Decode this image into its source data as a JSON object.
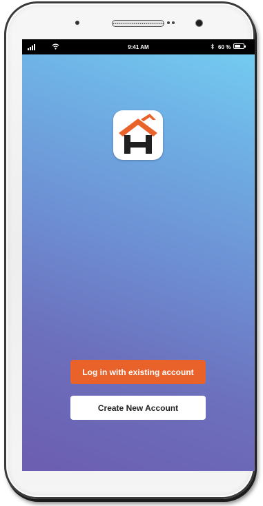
{
  "status_bar": {
    "time": "9:41 AM",
    "battery": "60 %",
    "bluetooth_glyph": "✳"
  },
  "app": {
    "icon": "house-h-logo-icon",
    "accent_color": "#e9622a"
  },
  "actions": {
    "login_label": "Log in with existing account",
    "create_label": "Create New Account"
  }
}
